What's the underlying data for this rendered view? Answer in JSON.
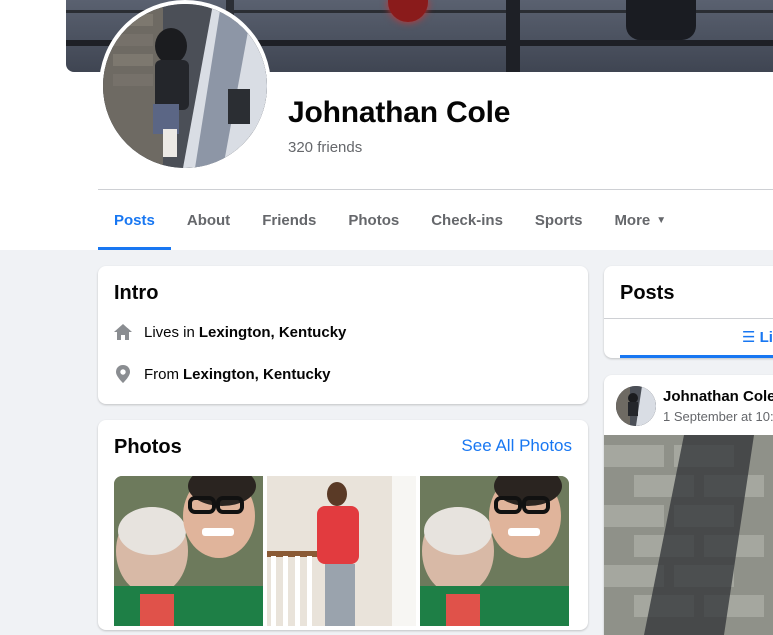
{
  "profile": {
    "name": "Johnathan Cole",
    "friends_count": "320 friends"
  },
  "tabs": [
    {
      "label": "Posts",
      "active": true
    },
    {
      "label": "About"
    },
    {
      "label": "Friends"
    },
    {
      "label": "Photos"
    },
    {
      "label": "Check-ins"
    },
    {
      "label": "Sports"
    },
    {
      "label": "More"
    }
  ],
  "intro": {
    "title": "Intro",
    "lives_prefix": "Lives in",
    "lives_place": "Lexington, Kentucky",
    "from_prefix": "From",
    "from_place": "Lexington, Kentucky",
    "icons": {
      "lives": "home-icon",
      "from": "location-pin-icon"
    }
  },
  "photos": {
    "title": "Photos",
    "see_all": "See All Photos"
  },
  "posts": {
    "title": "Posts",
    "filter_label": "Li",
    "post": {
      "author": "Johnathan Cole",
      "time": "1 September at 10:"
    }
  },
  "colors": {
    "accent": "#1877f2",
    "page_bg": "#f0f2f5",
    "secondary_text": "#65676b"
  }
}
